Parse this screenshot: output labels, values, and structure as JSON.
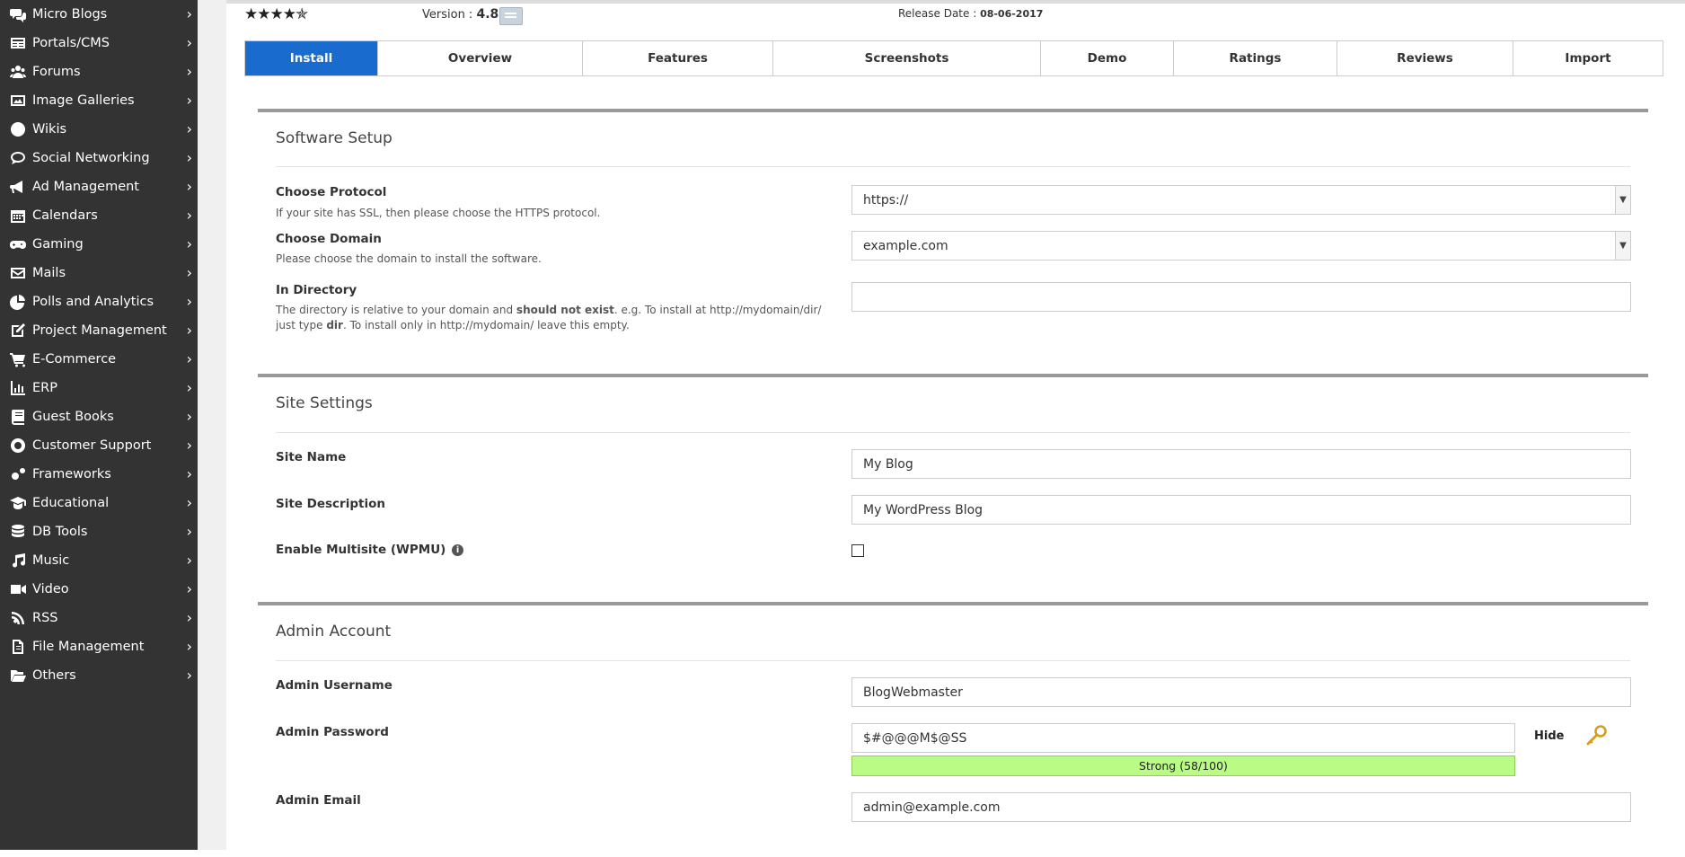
{
  "sidebar": {
    "items": [
      {
        "label": "Micro Blogs",
        "icon": "chat-bubbles-icon"
      },
      {
        "label": "Portals/CMS",
        "icon": "newspaper-icon"
      },
      {
        "label": "Forums",
        "icon": "users-icon"
      },
      {
        "label": "Image Galleries",
        "icon": "image-icon"
      },
      {
        "label": "Wikis",
        "icon": "globe-icon"
      },
      {
        "label": "Social Networking",
        "icon": "comment-icon"
      },
      {
        "label": "Ad Management",
        "icon": "megaphone-icon"
      },
      {
        "label": "Calendars",
        "icon": "calendar-icon"
      },
      {
        "label": "Gaming",
        "icon": "gamepad-icon"
      },
      {
        "label": "Mails",
        "icon": "envelope-icon"
      },
      {
        "label": "Polls and Analytics",
        "icon": "pie-chart-icon"
      },
      {
        "label": "Project Management",
        "icon": "edit-icon"
      },
      {
        "label": "E-Commerce",
        "icon": "cart-icon"
      },
      {
        "label": "ERP",
        "icon": "bar-chart-icon"
      },
      {
        "label": "Guest Books",
        "icon": "book-icon"
      },
      {
        "label": "Customer Support",
        "icon": "lifebuoy-icon"
      },
      {
        "label": "Frameworks",
        "icon": "cogs-icon"
      },
      {
        "label": "Educational",
        "icon": "graduation-cap-icon"
      },
      {
        "label": "DB Tools",
        "icon": "database-icon"
      },
      {
        "label": "Music",
        "icon": "music-icon"
      },
      {
        "label": "Video",
        "icon": "video-camera-icon"
      },
      {
        "label": "RSS",
        "icon": "rss-icon"
      },
      {
        "label": "File Management",
        "icon": "file-icon"
      },
      {
        "label": "Others",
        "icon": "folder-open-icon"
      }
    ],
    "chevron": "›"
  },
  "header": {
    "stars": "★★★★✯",
    "version_label": "Version : ",
    "version_value": "4.8",
    "release_label": "Release Date : ",
    "release_value": "08-06-2017"
  },
  "tabs": [
    "Install",
    "Overview",
    "Features",
    "Screenshots",
    "Demo",
    "Ratings",
    "Reviews",
    "Import"
  ],
  "software_setup": {
    "title": "Software Setup",
    "protocol_label": "Choose Protocol",
    "protocol_desc": "If your site has SSL, then please choose the HTTPS protocol.",
    "protocol_value": "https://",
    "domain_label": "Choose Domain",
    "domain_desc": "Please choose the domain to install the software.",
    "domain_value": "example.com",
    "directory_label": "In Directory",
    "directory_desc_1": "The directory is relative to your domain and ",
    "directory_desc_bold": "should not exist",
    "directory_desc_2": ". e.g. To install at http://mydomain/dir/ just type ",
    "directory_desc_bold2": "dir",
    "directory_desc_3": ". To install only in http://mydomain/ leave this empty.",
    "directory_value": ""
  },
  "site_settings": {
    "title": "Site Settings",
    "name_label": "Site Name",
    "name_value": "My Blog",
    "desc_label": "Site Description",
    "desc_value": "My WordPress Blog",
    "multisite_label": "Enable Multisite (WPMU)",
    "multisite_info": "i",
    "multisite_checked": false
  },
  "admin_account": {
    "title": "Admin Account",
    "username_label": "Admin Username",
    "username_value": "BlogWebmaster",
    "password_label": "Admin Password",
    "password_value": "$#@@@M$@SS",
    "strength": "Strong (58/100)",
    "hide_label": "Hide",
    "email_label": "Admin Email",
    "email_value": "admin@example.com"
  },
  "colors": {
    "sidebar_bg": "#333333",
    "tab_active": "#1a6bce",
    "strength_bar": "#b9fb84"
  }
}
